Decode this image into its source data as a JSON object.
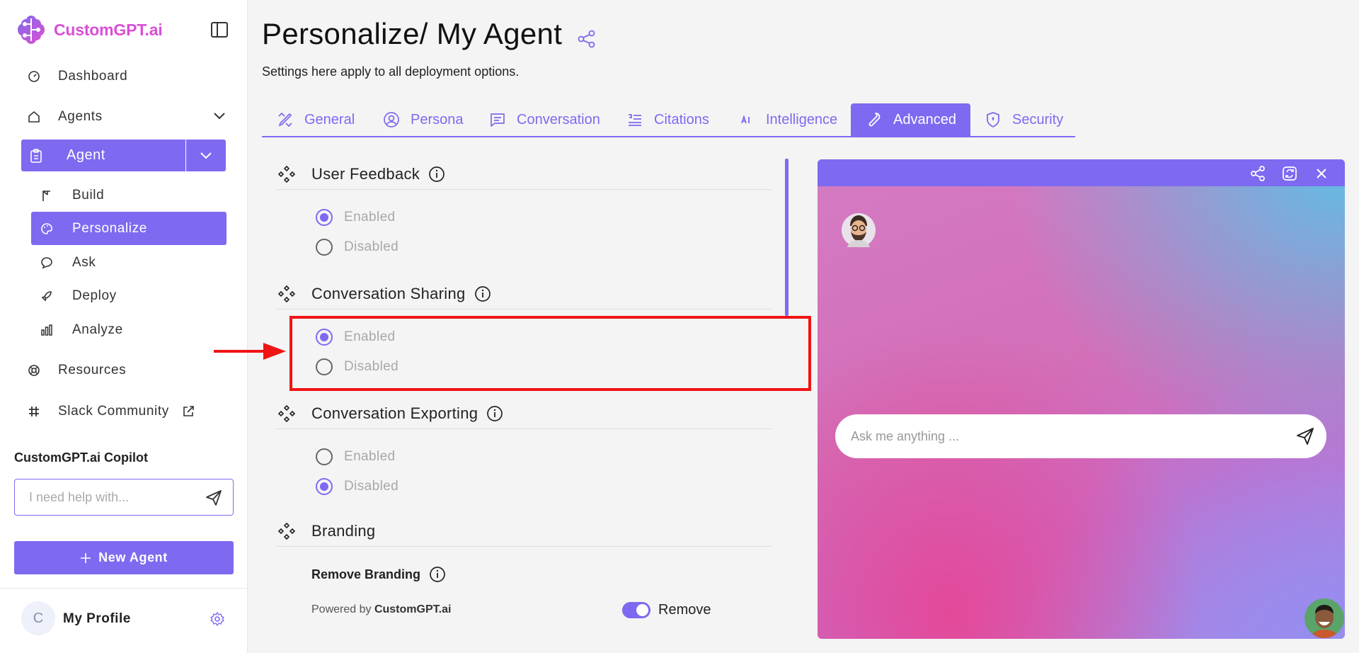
{
  "brand": {
    "name": "CustomGPT.ai",
    "accent": "#7d6af0",
    "logo_color": "#d94fd6"
  },
  "sidebar": {
    "items": [
      {
        "label": "Dashboard",
        "icon": "dashboard-icon"
      },
      {
        "label": "Agents",
        "icon": "home-icon"
      },
      {
        "label": "Agent",
        "icon": "clipboard-icon"
      },
      {
        "label": "Build",
        "icon": "crane-icon"
      },
      {
        "label": "Personalize",
        "icon": "palette-icon"
      },
      {
        "label": "Ask",
        "icon": "chat-icon"
      },
      {
        "label": "Deploy",
        "icon": "rocket-icon"
      },
      {
        "label": "Analyze",
        "icon": "bar-chart-icon"
      },
      {
        "label": "Resources",
        "icon": "lifebuoy-icon"
      },
      {
        "label": "Slack Community",
        "icon": "slack-icon"
      }
    ],
    "copilot": {
      "title": "CustomGPT.ai Copilot",
      "placeholder": "I need help with..."
    },
    "new_agent_label": "New Agent",
    "profile": {
      "initial": "C",
      "name": "My Profile"
    }
  },
  "main": {
    "title": "Personalize/ My Agent",
    "subtitle": "Settings here apply to all deployment options.",
    "tabs": [
      {
        "label": "General",
        "icon": "pencil-ruler-icon"
      },
      {
        "label": "Persona",
        "icon": "user-circle-icon"
      },
      {
        "label": "Conversation",
        "icon": "message-icon"
      },
      {
        "label": "Citations",
        "icon": "citations-icon"
      },
      {
        "label": "Intelligence",
        "icon": "ai-icon"
      },
      {
        "label": "Advanced",
        "icon": "wrench-icon",
        "active": true
      },
      {
        "label": "Security",
        "icon": "shield-icon"
      }
    ],
    "sections": {
      "user_feedback": {
        "title": "User Feedback",
        "enabled": "Enabled",
        "disabled": "Disabled",
        "selected": "Enabled"
      },
      "conversation_sharing": {
        "title": "Conversation Sharing",
        "enabled": "Enabled",
        "disabled": "Disabled",
        "selected": "Enabled"
      },
      "conversation_exporting": {
        "title": "Conversation Exporting",
        "enabled": "Enabled",
        "disabled": "Disabled",
        "selected": "Disabled"
      },
      "branding": {
        "title": "Branding",
        "remove_label": "Remove Branding",
        "powered_prefix": "Powered by",
        "powered_brand": "CustomGPT.ai",
        "toggle_label": "Remove",
        "toggle_on": true
      }
    }
  },
  "preview": {
    "placeholder": "Ask me anything ..."
  }
}
